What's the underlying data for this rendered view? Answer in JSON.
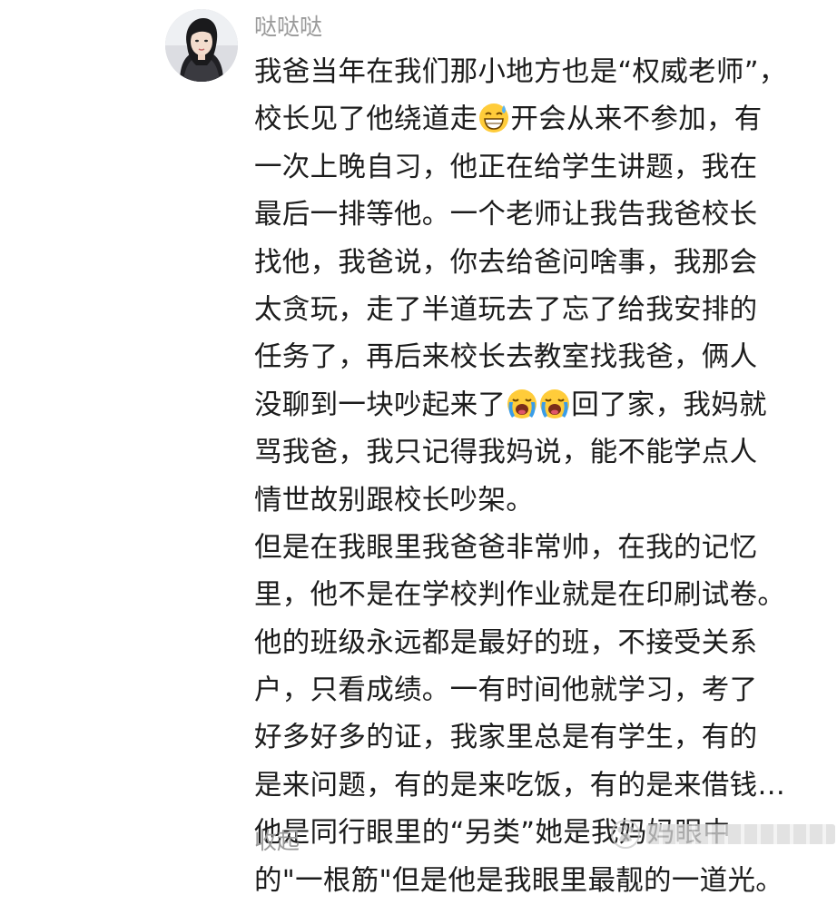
{
  "comment": {
    "username": "哒哒哒",
    "avatar_icon": "user-avatar-photo",
    "lines": [
      [
        "我爸当年在我们那小地方也是“权威老师”，"
      ],
      [
        "校长见了他绕道走",
        "😅",
        "开会从来不参加，有"
      ],
      [
        "一次上晚自习，他正在给学生讲题，我在"
      ],
      [
        "最后一排等他。一个老师让我告我爸校长"
      ],
      [
        "找他，我爸说，你去给爸问啥事，我那会"
      ],
      [
        "太贪玩，走了半道玩去了忘了给我安排的"
      ],
      [
        "任务了，再后来校长去教室找我爸，俩人"
      ],
      [
        "没聊到一块吵起来了",
        "😭",
        "😭",
        "回了家，我妈就"
      ],
      [
        "骂我爸，我只记得我妈说，能不能学点人"
      ],
      [
        "情世故别跟校长吵架。"
      ],
      [
        "但是在我眼里我爸爸非常帅，在我的记忆"
      ],
      [
        "里，他不是在学校判作业就是在印刷试卷。"
      ],
      [
        "他的班级永远都是最好的班，不接受关系"
      ],
      [
        "户，只看成绩。一有时间他就学习，考了"
      ],
      [
        "好多好多的证，我家里总是有学生，有的"
      ],
      [
        "是来问题，有的是来吃饭，有的是来借钱…"
      ],
      [
        "他是同行眼里的“另类”她是我妈妈眼中"
      ],
      [
        "的\"一根筋\"但是他是我眼里最靓的一道光。"
      ]
    ],
    "collapse_label": "收起"
  },
  "watermark": {
    "logo_icon": "paw-logo-icon"
  },
  "colors": {
    "text": "#1c1c1c",
    "meta": "#9a9a9a",
    "background": "#ffffff"
  }
}
